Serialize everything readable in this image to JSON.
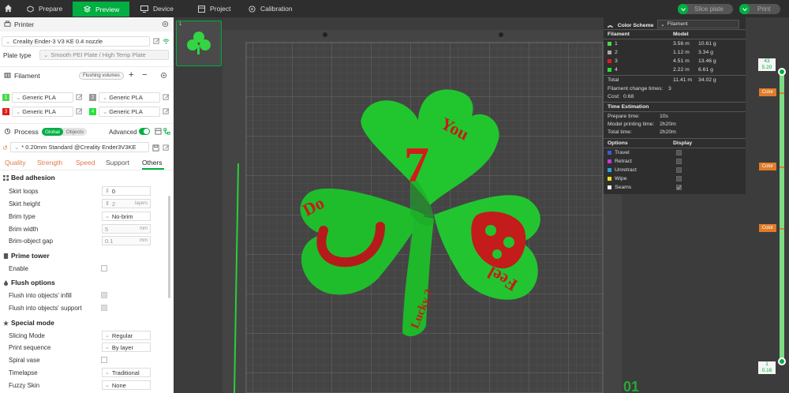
{
  "topbar": {
    "tabs": [
      {
        "label": "Prepare"
      },
      {
        "label": "Preview"
      },
      {
        "label": "Device"
      },
      {
        "label": "Project"
      },
      {
        "label": "Calibration"
      }
    ],
    "slice_label": "Slice plate",
    "print_label": "Print"
  },
  "printer": {
    "section_label": "Printer",
    "name": "Creality Ender-3 V3 KE 0.4 nozzle",
    "plate_type_label": "Plate type",
    "plate_type_value": "Smooth PEI Plate / High Temp Plate"
  },
  "filament": {
    "section_label": "Filament",
    "flushing_label": "Flushing volumes",
    "items": [
      {
        "index": "1",
        "name": "Generic PLA",
        "color": "#4cd94c"
      },
      {
        "index": "2",
        "name": "Generic PLA",
        "color": "#9a9a9a"
      },
      {
        "index": "3",
        "name": "Generic PLA",
        "color": "#e01b1b"
      },
      {
        "index": "4",
        "name": "Generic PLA",
        "color": "#27e03a"
      }
    ]
  },
  "process": {
    "section_label": "Process",
    "global_label": "Global",
    "objects_label": "Objects",
    "advanced_label": "Advanced",
    "preset": "* 0.20mm Standard @Creality Ender3V3KE",
    "tabs": [
      "Quality",
      "Strength",
      "Speed",
      "Support",
      "Others"
    ],
    "active_tab": "Others"
  },
  "groups": {
    "bed_adhesion": "Bed adhesion",
    "prime_tower": "Prime tower",
    "flush_options": "Flush options",
    "special_mode": "Special mode"
  },
  "options": {
    "skirt_loops": {
      "label": "Skirt loops",
      "value": "0"
    },
    "skirt_height": {
      "label": "Skirt height",
      "value": "2",
      "unit": "layers"
    },
    "brim_type": {
      "label": "Brim type",
      "value": "No-brim"
    },
    "brim_width": {
      "label": "Brim width",
      "value": "5",
      "unit": "mm"
    },
    "brim_gap": {
      "label": "Brim-object gap",
      "value": "0.1",
      "unit": "mm"
    },
    "enable": {
      "label": "Enable"
    },
    "flush_infill": {
      "label": "Flush into objects' infill"
    },
    "flush_support": {
      "label": "Flush into objects' support"
    },
    "slicing_mode": {
      "label": "Slicing Mode",
      "value": "Regular"
    },
    "print_sequence": {
      "label": "Print sequence",
      "value": "By layer"
    },
    "spiral_vase": {
      "label": "Spiral vase"
    },
    "timelapse": {
      "label": "Timelapse",
      "value": "Traditional"
    },
    "fuzzy_skin": {
      "label": "Fuzzy Skin",
      "value": "None"
    }
  },
  "viewport": {
    "plate_number": "1",
    "model_text": [
      "Do",
      "You",
      "Feel",
      "Lucky ?",
      "7"
    ],
    "bed_marker": "01"
  },
  "color_scheme": {
    "title": "Color Scheme",
    "mode": "Filament",
    "col_filament": "Filament",
    "col_model": "Model",
    "rows": [
      {
        "id": "1",
        "len": "3.56 m",
        "wt": "10.61 g",
        "color": "#4cd94c"
      },
      {
        "id": "2",
        "len": "1.12 m",
        "wt": "3.34 g",
        "color": "#aaaaaa"
      },
      {
        "id": "3",
        "len": "4.51 m",
        "wt": "13.46 g",
        "color": "#e01b1b"
      },
      {
        "id": "4",
        "len": "2.22 m",
        "wt": "6.61 g",
        "color": "#27e03a"
      }
    ],
    "total_label": "Total",
    "total_len": "11.41 m",
    "total_wt": "34.02 g",
    "change_label": "Filament change times:",
    "change_val": "3",
    "cost_label": "Cost:",
    "cost_val": "0.68",
    "time_title": "Time Estimation",
    "prepare_label": "Prepare time:",
    "prepare_val": "10s",
    "model_time_label": "Model printing time:",
    "model_time_val": "2h20m",
    "total_time_label": "Total time:",
    "total_time_val": "2h20m",
    "options_label": "Options",
    "display_label": "Display",
    "display_options": [
      {
        "name": "Travel",
        "color": "#3b5bdb"
      },
      {
        "name": "Retract",
        "color": "#c03bd6"
      },
      {
        "name": "Unretract",
        "color": "#2aa4d4"
      },
      {
        "name": "Wipe",
        "color": "#f0e020"
      },
      {
        "name": "Seams",
        "color": "#eeeeee"
      }
    ]
  },
  "layers": {
    "top_layer": "43",
    "top_height": "5.20",
    "bottom_layer": "1",
    "bottom_height": "0.16",
    "color_tag": "Color"
  }
}
